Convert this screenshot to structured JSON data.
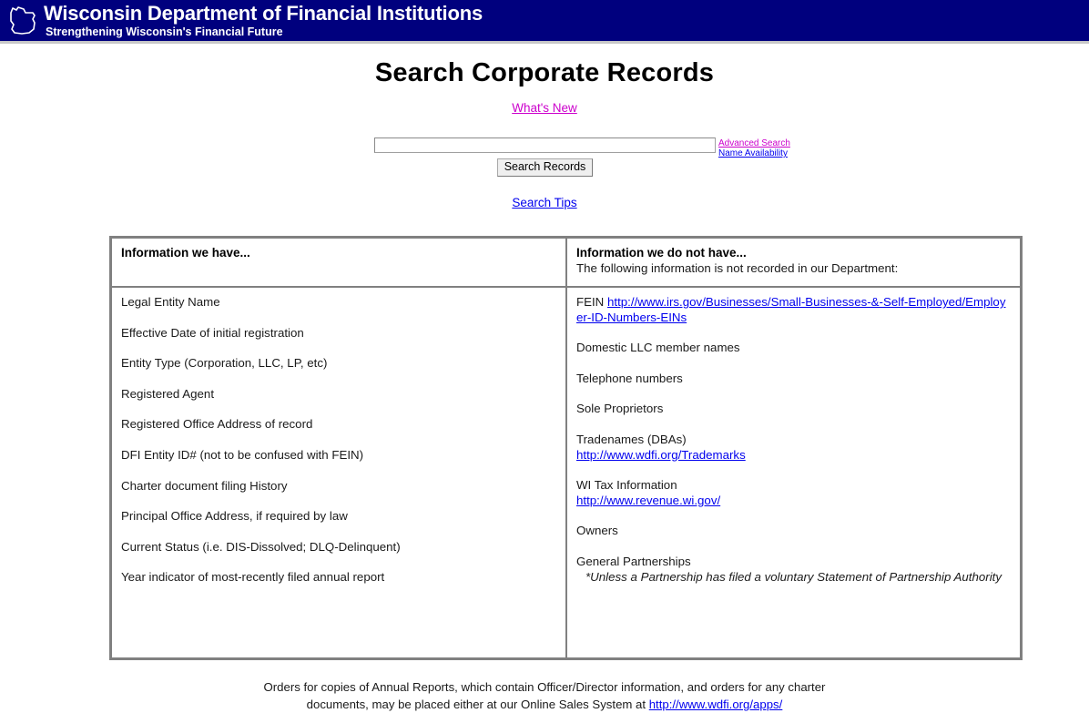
{
  "banner": {
    "logo_alt": "wisconsin-state-outline",
    "title": "Wisconsin Department of Financial Institutions",
    "subtitle": "Strengthening Wisconsin's Financial Future",
    "background_color": "#00007e"
  },
  "page": {
    "title": "Search Corporate Records",
    "whats_new_label": "What's New",
    "search_tips_label": "Search Tips"
  },
  "search": {
    "input_value": "",
    "input_placeholder": "",
    "button_label": "Search Records",
    "advanced_search_label": "Advanced Search",
    "name_availability_label": "Name Availability"
  },
  "table": {
    "have": {
      "header": "Information we have...",
      "items": [
        "Legal Entity Name",
        "Effective Date of initial registration",
        "Entity Type (Corporation, LLC, LP, etc)",
        "Registered Agent",
        "Registered Office Address of record",
        "DFI Entity ID# (not to be confused with FEIN)",
        "Charter document filing History",
        "Principal Office Address, if required by law",
        "Current Status (i.e. DIS-Dissolved; DLQ-Delinquent)",
        "Year indicator of most-recently filed annual report"
      ]
    },
    "not_have": {
      "header": "Information we do not have...",
      "subheader": "The following information is not recorded in our Department:",
      "items": [
        {
          "label": "FEIN",
          "link": "http://www.irs.gov/Businesses/Small-Businesses-&-Self-Employed/Employer-ID-Numbers-EINs",
          "inline_link": true
        },
        {
          "label": "Domestic LLC member names"
        },
        {
          "label": "Telephone numbers"
        },
        {
          "label": "Sole Proprietors"
        },
        {
          "label": "Tradenames (DBAs)",
          "link": "http://www.wdfi.org/Trademarks"
        },
        {
          "label": "WI Tax Information",
          "link": "http://www.revenue.wi.gov/"
        },
        {
          "label": "Owners"
        },
        {
          "label": "General Partnerships",
          "note": "*Unless a Partnership has filed a voluntary Statement of Partnership Authority"
        }
      ]
    }
  },
  "footer": {
    "line1": "Orders for copies of Annual Reports, which contain Officer/Director information, and orders for any charter",
    "line2": "documents, may be placed either at our Online Sales System at",
    "line2_link": "http://www.wdfi.org/apps/"
  },
  "colors": {
    "banner_blue": "#00007e",
    "link_blue": "#0000ee",
    "link_visited": "#cc00cc",
    "table_border": "#808080"
  }
}
